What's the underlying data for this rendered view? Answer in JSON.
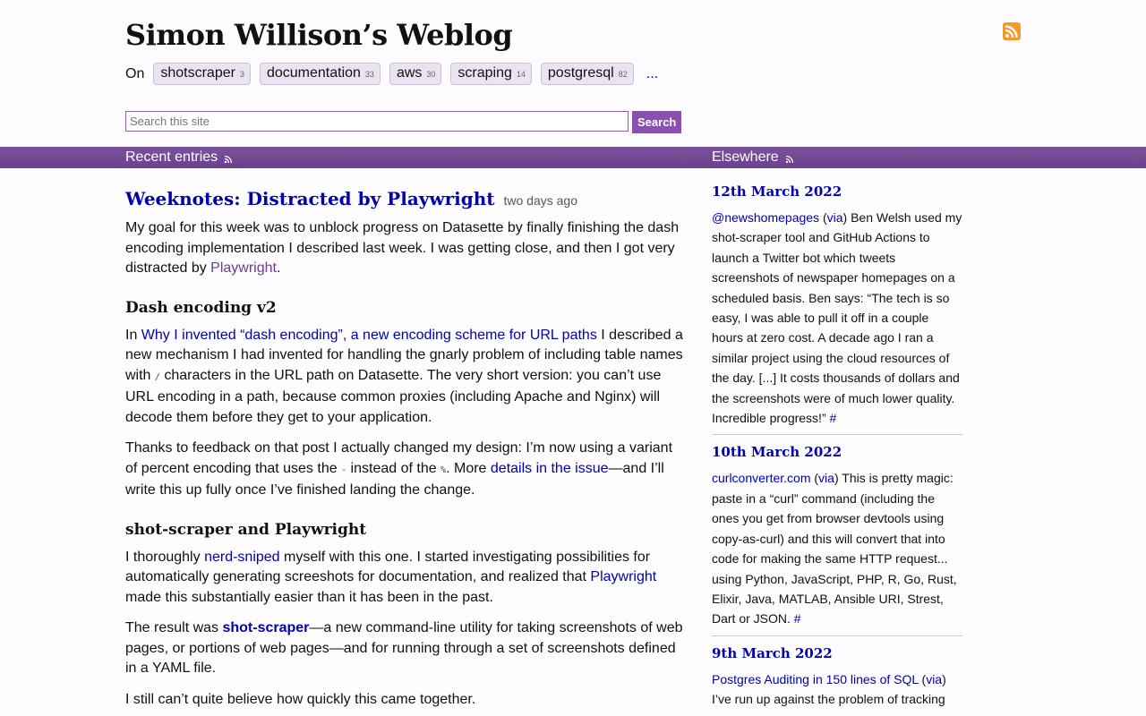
{
  "site": {
    "title": "Simon Willison’s Weblog",
    "tagline_prefix": "On",
    "more": "..."
  },
  "tags": [
    {
      "name": "shotscraper",
      "count": "3"
    },
    {
      "name": "documentation",
      "count": "33"
    },
    {
      "name": "aws",
      "count": "30"
    },
    {
      "name": "scraping",
      "count": "14"
    },
    {
      "name": "postgresql",
      "count": "82"
    }
  ],
  "search": {
    "placeholder": "Search this site",
    "button": "Search"
  },
  "bar": {
    "recent": "Recent entries",
    "elsewhere": "Elsewhere"
  },
  "entry": {
    "title": "Weeknotes: Distracted by Playwright",
    "date": "two days ago",
    "intro_1": "My goal for this week was to unblock progress on Datasette by finally finishing the dash encoding implementation I described last week. I was getting close, and then I got very distracted by ",
    "intro_link": "Playwright",
    "intro_2": ".",
    "h_dash": "Dash encoding v2",
    "p2_a": "In ",
    "p2_link": "Why I invented “dash encoding”, a new encoding scheme for URL paths",
    "p2_b": " I described a new mechanism I had invented for handling the gnarly problem of including table names with ",
    "p2_code": "/",
    "p2_c": " characters in the URL path on Datasette. The very short version: you can’t use URL encoding in a path, because common proxies (including Apache and Nginx) will decode them before they get to your application.",
    "p3_a": "Thanks to feedback on that post I actually changed my design: I’m now using a variant of percent encoding that uses the ",
    "p3_code1": "-",
    "p3_b": " instead of the ",
    "p3_code2": "%",
    "p3_c": ". More ",
    "p3_link": "details in the issue",
    "p3_d": "—and I’ll write this up fully once I’ve finished landing the change.",
    "h_shot": "shot-scraper and Playwright",
    "p4_a": "I thoroughly ",
    "p4_link1": "nerd-sniped",
    "p4_b": " myself with this one. I started investigating possibilities for automatically generating screeshots for documentation, and realized that ",
    "p4_link2": "Playwright",
    "p4_c": " made this substantially easier than it has been in the past.",
    "p5_a": "The result was ",
    "p5_link": "shot-scraper",
    "p5_b": "—a new command-line utility for taking screenshots of web pages, or portions of web pages—and for running through a set of screenshots defined in a YAML file.",
    "p6": "I still can’t quite believe how quickly this came together."
  },
  "elsewhere": [
    {
      "date": "12th March 2022",
      "link": "@newshomepages",
      "via": "via",
      "text": " Ben Welsh used my shot-scraper tool and GitHub Actions to launch a Twitter bot which tweets screenshots of newspaper homepages on a scheduled basis. Ben says: “The tech is so easy, I was able to pull it off in a couple hours at zero cost. A decade ago I ran a similar project using the cloud resources of the day. [...] It costs thousands of dollars and the screenshots were of much lower quality. Incredible progress!” ",
      "hash": "#"
    },
    {
      "date": "10th March 2022",
      "link": "curlconverter.com",
      "via": "via",
      "text": " This is pretty magic: paste in a “curl” command (including the ones you get from browser devtools using copy-as-curl) and this will convert that into code for making the same HTTP request... using Python, JavaScript, PHP, R, Go, Rust, Elixir, Java, MATLAB, Ansible URI, Strest, Dart or JSON. ",
      "hash": "#"
    },
    {
      "date": "9th March 2022",
      "link": "Postgres Auditing in 150 lines of SQL",
      "via": "via",
      "text": " I’ve run up against the problem of tracking"
    }
  ]
}
